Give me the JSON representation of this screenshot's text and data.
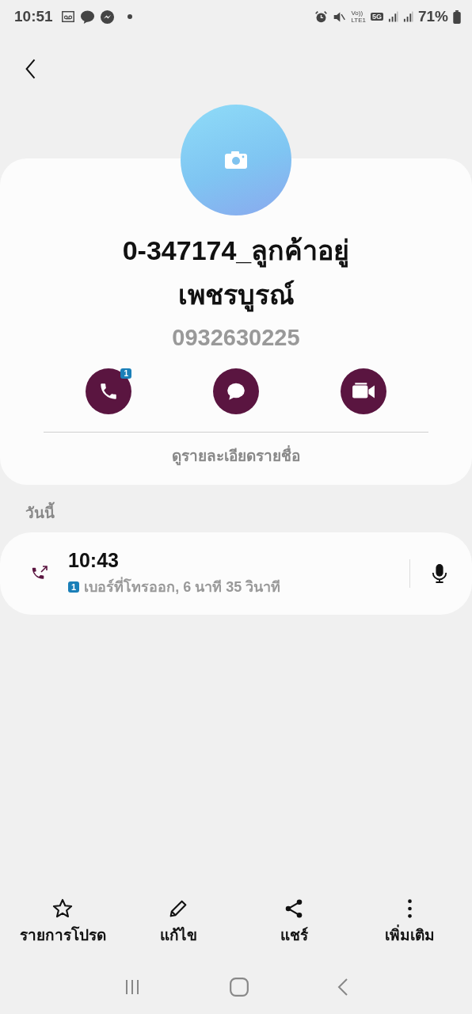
{
  "status_bar": {
    "time": "10:51",
    "volte": "Vo))",
    "lte": "LTE1",
    "network": "5G",
    "battery": "71%"
  },
  "contact": {
    "name": "0-347174_ลูกค้าอยู่ เพชรบูรณ์",
    "phone": "0932630225",
    "sim_badge": "1",
    "details_link": "ดูรายละเอียดรายชื่อ"
  },
  "section_title": "วันนี้",
  "calls": [
    {
      "time": "10:43",
      "sim": "1",
      "description": "เบอร์ที่โทรออก, 6 นาที 35 วินาที",
      "kind": "outgoing"
    }
  ],
  "bottom_actions": [
    {
      "label": "รายการโปรด",
      "kind": "star"
    },
    {
      "label": "แก้ไข",
      "kind": "edit"
    },
    {
      "label": "แชร์",
      "kind": "share"
    },
    {
      "label": "เพิ่มเติม",
      "kind": "more"
    }
  ]
}
